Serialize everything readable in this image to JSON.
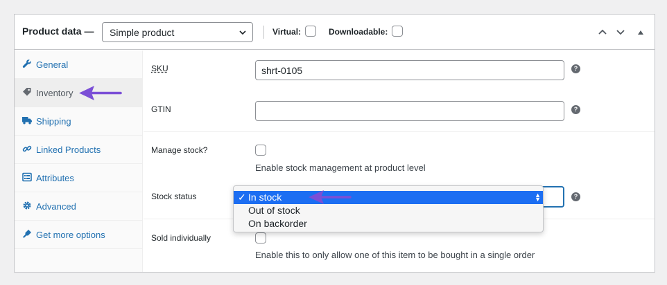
{
  "header": {
    "title": "Product data —",
    "product_type": "Simple product",
    "virtual_label": "Virtual:",
    "downloadable_label": "Downloadable:"
  },
  "tabs": [
    {
      "label": "General",
      "icon": "wrench-icon"
    },
    {
      "label": "Inventory",
      "icon": "tag-icon",
      "active": true
    },
    {
      "label": "Shipping",
      "icon": "truck-icon"
    },
    {
      "label": "Linked Products",
      "icon": "link-icon"
    },
    {
      "label": "Attributes",
      "icon": "list-icon"
    },
    {
      "label": "Advanced",
      "icon": "gear-icon"
    },
    {
      "label": "Get more options",
      "icon": "plugin-icon"
    }
  ],
  "fields": {
    "sku_label": "SKU",
    "sku_value": "shrt-0105",
    "gtin_label": "GTIN",
    "gtin_value": "",
    "manage_stock_label": "Manage stock?",
    "manage_stock_desc": "Enable stock management at product level",
    "stock_status_label": "Stock status",
    "sold_individually_label": "Sold individually",
    "sold_individually_desc": "Enable this to only allow one of this item to be bought in a single order"
  },
  "stock_status_options": [
    "In stock",
    "Out of stock",
    "On backorder"
  ],
  "stock_status_selected": "In stock",
  "colors": {
    "link": "#2271b1",
    "selection": "#1c6ef2",
    "annotation_arrow": "#7b4fd6"
  }
}
